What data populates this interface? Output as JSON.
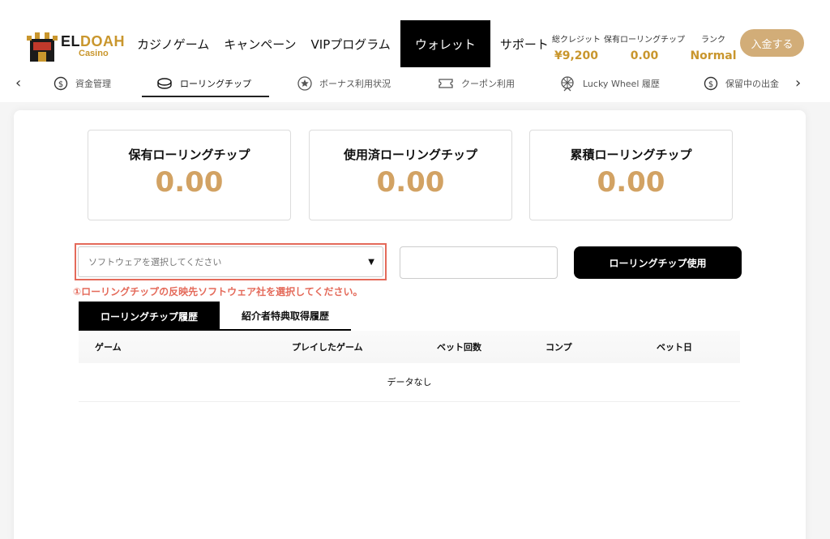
{
  "brand": {
    "name_dark": "EL",
    "name_gold": "DOAH",
    "sub": "Casino"
  },
  "nav": [
    "カジノゲーム",
    "キャンペーン",
    "VIPプログラム",
    "ウォレット",
    "サポート"
  ],
  "stats": {
    "credit": {
      "label": "総クレジット",
      "value": "¥9,200"
    },
    "chips": {
      "label": "保有ローリングチップ",
      "value": "0.00"
    },
    "rank": {
      "label": "ランク",
      "value": "Normal"
    }
  },
  "deposit_label": "入金する",
  "subnav": [
    "資金管理",
    "ローリングチップ",
    "ボーナス利用状況",
    "クーポン利用",
    "Lucky Wheel 履歴",
    "保留中の出金"
  ],
  "summary": [
    {
      "label": "保有ローリングチップ",
      "value": "0.00"
    },
    {
      "label": "使用済ローリングチップ",
      "value": "0.00"
    },
    {
      "label": "累積ローリングチップ",
      "value": "0.00"
    }
  ],
  "select_placeholder": "ソフトウェアを選択してください",
  "use_button": "ローリングチップ使用",
  "warning": "①ローリングチップの反映先ソフトウェア社を選択してください。",
  "tabs": [
    "ローリングチップ履歴",
    "紹介者特典取得履歴"
  ],
  "table": {
    "headers": [
      "ゲーム",
      "プレイしたゲーム",
      "ベット回数",
      "コンプ",
      "ベット日"
    ],
    "empty": "データなし"
  }
}
